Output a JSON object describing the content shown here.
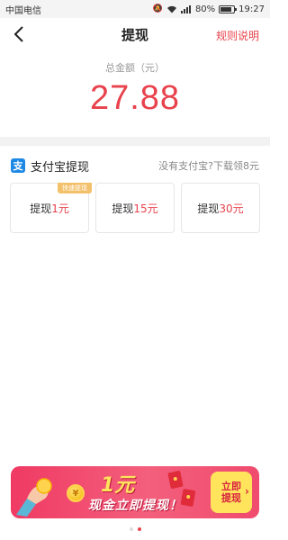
{
  "status_bar": {
    "carrier": "中国电信",
    "battery": "80%",
    "time": "19:27"
  },
  "nav": {
    "title": "提现",
    "rules": "规则说明"
  },
  "balance": {
    "label": "总金额（元）",
    "value": "27.88"
  },
  "alipay": {
    "title": "支付宝提现",
    "icon_char": "支",
    "hint": "没有支付宝?下载领8元",
    "fast_tag": "快速提现",
    "options": [
      {
        "prefix": "提现",
        "amount": "1元"
      },
      {
        "prefix": "提现",
        "amount": "15元"
      },
      {
        "prefix": "提现",
        "amount": "30元"
      }
    ]
  },
  "banner": {
    "big": "1元",
    "sub": "现金立即提现！",
    "button_line1": "立即",
    "button_line2": "提现",
    "coin_char": "¥"
  },
  "carousel": {
    "active_index": 1,
    "count": 2
  },
  "colors": {
    "accent": "#e8424c",
    "alipay_blue": "#1e88e5",
    "banner_yellow": "#ffe45c"
  }
}
